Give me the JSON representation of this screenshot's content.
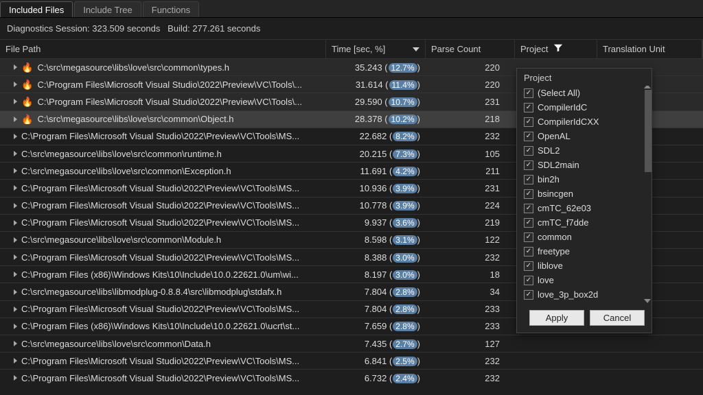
{
  "tabs": {
    "included_files": "Included Files",
    "include_tree": "Include Tree",
    "functions": "Functions"
  },
  "status": {
    "session_label": "Diagnostics Session:",
    "session_sec": "323.509 seconds",
    "build_label": "Build:",
    "build_sec": "277.261 seconds"
  },
  "headers": {
    "file_path": "File Path",
    "time": "Time [sec, %]",
    "parse_count": "Parse Count",
    "project": "Project",
    "translation_unit": "Translation Unit"
  },
  "rows": [
    {
      "hot": true,
      "path": "C:\\src\\megasource\\libs\\love\\src\\common\\types.h",
      "time": "35.243",
      "pct": "12.7%",
      "count": "220"
    },
    {
      "hot": true,
      "path": "C:\\Program Files\\Microsoft Visual Studio\\2022\\Preview\\VC\\Tools\\...",
      "time": "31.614",
      "pct": "11.4%",
      "count": "220"
    },
    {
      "hot": true,
      "path": "C:\\Program Files\\Microsoft Visual Studio\\2022\\Preview\\VC\\Tools\\...",
      "time": "29.590",
      "pct": "10.7%",
      "count": "231"
    },
    {
      "hot": true,
      "sel": true,
      "path": "C:\\src\\megasource\\libs\\love\\src\\common\\Object.h",
      "time": "28.378",
      "pct": "10.2%",
      "count": "218"
    },
    {
      "hot": false,
      "path": "C:\\Program Files\\Microsoft Visual Studio\\2022\\Preview\\VC\\Tools\\MS...",
      "time": "22.682",
      "pct": "8.2%",
      "count": "232"
    },
    {
      "hot": false,
      "path": "C:\\src\\megasource\\libs\\love\\src\\common\\runtime.h",
      "time": "20.215",
      "pct": "7.3%",
      "count": "105"
    },
    {
      "hot": false,
      "path": "C:\\src\\megasource\\libs\\love\\src\\common\\Exception.h",
      "time": "11.691",
      "pct": "4.2%",
      "count": "211"
    },
    {
      "hot": false,
      "path": "C:\\Program Files\\Microsoft Visual Studio\\2022\\Preview\\VC\\Tools\\MS...",
      "time": "10.936",
      "pct": "3.9%",
      "count": "231"
    },
    {
      "hot": false,
      "path": "C:\\Program Files\\Microsoft Visual Studio\\2022\\Preview\\VC\\Tools\\MS...",
      "time": "10.778",
      "pct": "3.9%",
      "count": "224"
    },
    {
      "hot": false,
      "path": "C:\\Program Files\\Microsoft Visual Studio\\2022\\Preview\\VC\\Tools\\MS...",
      "time": "9.937",
      "pct": "3.6%",
      "count": "219"
    },
    {
      "hot": false,
      "path": "C:\\src\\megasource\\libs\\love\\src\\common\\Module.h",
      "time": "8.598",
      "pct": "3.1%",
      "count": "122"
    },
    {
      "hot": false,
      "path": "C:\\Program Files\\Microsoft Visual Studio\\2022\\Preview\\VC\\Tools\\MS...",
      "time": "8.388",
      "pct": "3.0%",
      "count": "232"
    },
    {
      "hot": false,
      "path": "C:\\Program Files (x86)\\Windows Kits\\10\\Include\\10.0.22621.0\\um\\wi...",
      "time": "8.197",
      "pct": "3.0%",
      "count": "18"
    },
    {
      "hot": false,
      "path": "C:\\src\\megasource\\libs\\libmodplug-0.8.8.4\\src\\libmodplug\\stdafx.h",
      "time": "7.804",
      "pct": "2.8%",
      "count": "34"
    },
    {
      "hot": false,
      "path": "C:\\Program Files\\Microsoft Visual Studio\\2022\\Preview\\VC\\Tools\\MS...",
      "time": "7.804",
      "pct": "2.8%",
      "count": "233"
    },
    {
      "hot": false,
      "path": "C:\\Program Files (x86)\\Windows Kits\\10\\Include\\10.0.22621.0\\ucrt\\st...",
      "time": "7.659",
      "pct": "2.8%",
      "count": "233"
    },
    {
      "hot": false,
      "path": "C:\\src\\megasource\\libs\\love\\src\\common\\Data.h",
      "time": "7.435",
      "pct": "2.7%",
      "count": "127"
    },
    {
      "hot": false,
      "path": "C:\\Program Files\\Microsoft Visual Studio\\2022\\Preview\\VC\\Tools\\MS...",
      "time": "6.841",
      "pct": "2.5%",
      "count": "232"
    },
    {
      "hot": false,
      "path": "C:\\Program Files\\Microsoft Visual Studio\\2022\\Preview\\VC\\Tools\\MS...",
      "time": "6.732",
      "pct": "2.4%",
      "count": "232"
    }
  ],
  "filter": {
    "title": "Project",
    "items": [
      "(Select All)",
      "CompilerIdC",
      "CompilerIdCXX",
      "OpenAL",
      "SDL2",
      "SDL2main",
      "bin2h",
      "bsincgen",
      "cmTC_62e03",
      "cmTC_f7dde",
      "common",
      "freetype",
      "liblove",
      "love",
      "love_3p_box2d"
    ],
    "apply": "Apply",
    "cancel": "Cancel"
  }
}
